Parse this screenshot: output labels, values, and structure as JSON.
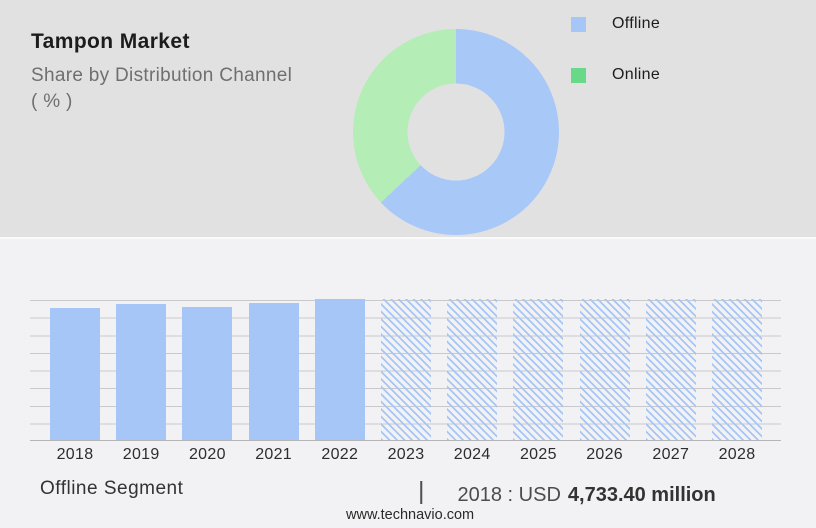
{
  "header": {
    "title": "Tampon Market",
    "subtitle_line1": "Share by Distribution Channel",
    "subtitle_line2": "( % )"
  },
  "footer": {
    "segment_label": "Offline Segment",
    "divider": "|",
    "stat_prefix": "2018 : USD",
    "stat_value": "4,733.40 million",
    "website": "www.technavio.com"
  },
  "colors": {
    "top_background": "#e1e1e2",
    "bottom_background": "#f2f2f4",
    "donut_offline": "#a8c8f8",
    "donut_online": "#b5edb6",
    "legend_offline_swatch": "#a6c6f7",
    "legend_online_swatch": "#68d989",
    "bar_fill": "#a5c6f7",
    "gridline": "#c9c9cb"
  },
  "chart_data": [
    {
      "type": "pie",
      "title": "Tampon Market - Share by Distribution Channel ( % )",
      "labels": [
        "Offline",
        "Online"
      ],
      "values": [
        63,
        37
      ],
      "colors": [
        "#a8c8f8",
        "#b5edb6"
      ],
      "legend_colors": [
        "#a6c6f7",
        "#68d989"
      ],
      "donut": true,
      "start_angle_deg": 0,
      "direction": "clockwise",
      "legend_position": "right"
    },
    {
      "type": "bar",
      "title": "Offline Segment market size by year (no y-axis labels shown; heights relative, 2022 = 100)",
      "categories": [
        "2018",
        "2019",
        "2020",
        "2021",
        "2022",
        "2023",
        "2024",
        "2025",
        "2026",
        "2027",
        "2028"
      ],
      "values": [
        93.7,
        96.7,
        94.4,
        97.2,
        100,
        100,
        100,
        100,
        100,
        100,
        100
      ],
      "historical_categories": [
        "2018",
        "2019",
        "2020",
        "2021",
        "2022"
      ],
      "forecast_categories": [
        "2023",
        "2024",
        "2025",
        "2026",
        "2027",
        "2028"
      ],
      "forecast_style": "hatched",
      "bar_color": "#a5c6f7",
      "ylim": [
        0,
        100
      ],
      "grid": true,
      "gridline_count": 9,
      "annotation": "2018 : USD 4,733.40 million"
    }
  ]
}
